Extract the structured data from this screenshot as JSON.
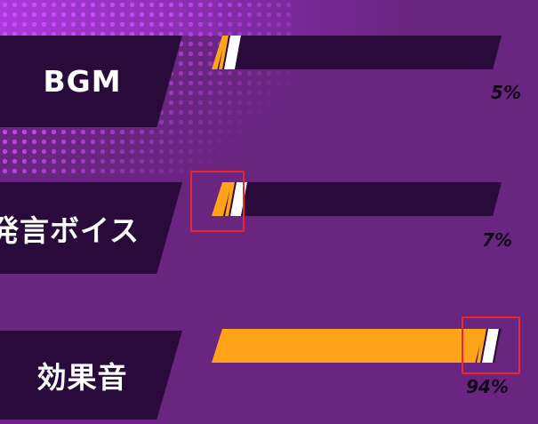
{
  "settings": [
    {
      "label": "BGM",
      "value": 0.05,
      "value_text": "5%"
    },
    {
      "label": "発言ボイス",
      "value": 0.07,
      "value_text": "7%"
    },
    {
      "label": "効果音",
      "value": 0.94,
      "value_text": "94%"
    }
  ],
  "colors": {
    "background": "#6a2580",
    "panel": "#2a0a3a",
    "fill": "#ffa31a",
    "thumb": "#ffffff",
    "highlight": "#e8282a"
  },
  "icons": {
    "thumb": "slash-thumb-icon"
  }
}
